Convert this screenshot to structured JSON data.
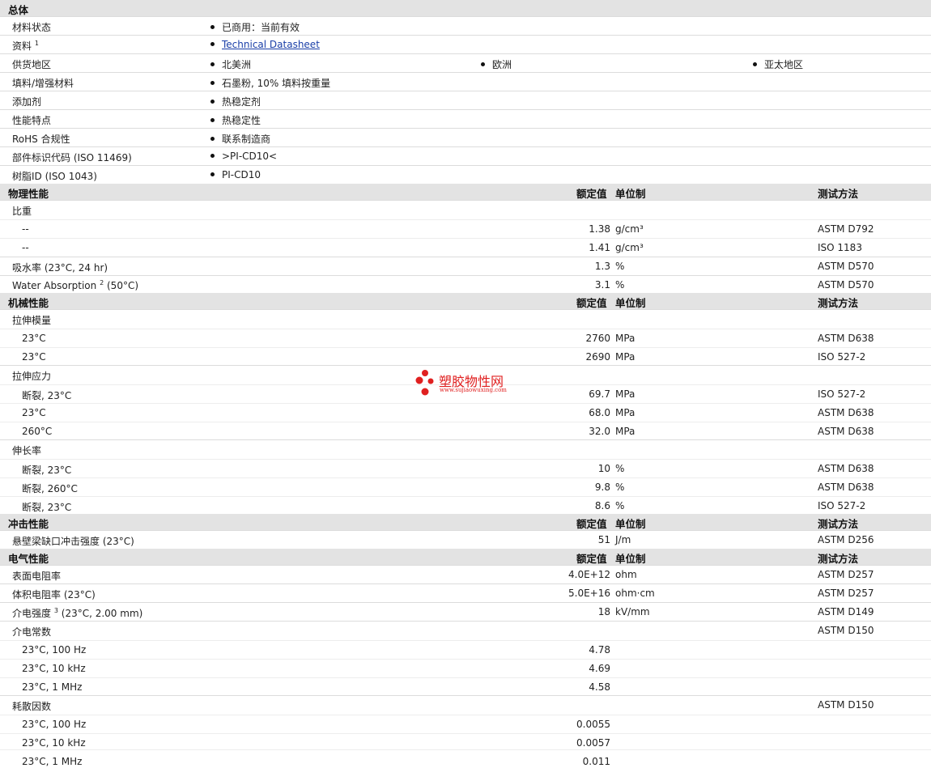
{
  "sections": {
    "general": {
      "title": "总体",
      "rows": [
        {
          "label": "材料状态",
          "values": [
            "已商用：当前有效"
          ]
        },
        {
          "label": "资料",
          "sup": "1",
          "values": [
            "Technical Datasheet"
          ]
        },
        {
          "label": "供货地区",
          "values": [
            "北美洲",
            "欧洲",
            "亚太地区"
          ]
        },
        {
          "label": "填料/增强材料",
          "values": [
            "石墨粉, 10% 填料按重量"
          ]
        },
        {
          "label": "添加剂",
          "values": [
            "热稳定剂"
          ]
        },
        {
          "label": "性能特点",
          "values": [
            "热稳定性"
          ]
        },
        {
          "label": "RoHS 合规性",
          "values": [
            "联系制造商"
          ]
        },
        {
          "label": "部件标识代码 (ISO 11469)",
          "values": [
            ">PI-CD10<"
          ]
        },
        {
          "label": "树脂ID (ISO 1043)",
          "values": [
            "PI-CD10"
          ]
        }
      ]
    },
    "col_headers": {
      "value": "额定值",
      "unit": "单位制",
      "method": "测试方法"
    },
    "physical": {
      "title": "物理性能",
      "rows": [
        {
          "label": "比重",
          "value": "",
          "unit": "",
          "method": ""
        },
        {
          "label": "--",
          "value": "1.38",
          "unit": "g/cm³",
          "method": "ASTM D792"
        },
        {
          "label": "--",
          "value": "1.41",
          "unit": "g/cm³",
          "method": "ISO 1183"
        },
        {
          "label": "吸水率 (23°C, 24 hr)",
          "value": "1.3",
          "unit": "%",
          "method": "ASTM D570"
        },
        {
          "label": "Water Absorption",
          "sup": "2",
          "label_tail": "(50°C)",
          "value": "3.1",
          "unit": "%",
          "method": "ASTM D570"
        }
      ]
    },
    "mechanical": {
      "title": "机械性能",
      "rows": [
        {
          "label": "拉伸模量",
          "value": "",
          "unit": "",
          "method": ""
        },
        {
          "label": "23°C",
          "value": "2760",
          "unit": "MPa",
          "method": "ASTM D638"
        },
        {
          "label": "23°C",
          "value": "2690",
          "unit": "MPa",
          "method": "ISO 527-2"
        },
        {
          "label": "拉伸应力",
          "value": "",
          "unit": "",
          "method": ""
        },
        {
          "label": "断裂, 23°C",
          "value": "69.7",
          "unit": "MPa",
          "method": "ISO 527-2"
        },
        {
          "label": "23°C",
          "value": "68.0",
          "unit": "MPa",
          "method": "ASTM D638"
        },
        {
          "label": "260°C",
          "value": "32.0",
          "unit": "MPa",
          "method": "ASTM D638"
        },
        {
          "label": "伸长率",
          "value": "",
          "unit": "",
          "method": ""
        },
        {
          "label": "断裂, 23°C",
          "value": "10",
          "unit": "%",
          "method": "ASTM D638"
        },
        {
          "label": "断裂, 260°C",
          "value": "9.8",
          "unit": "%",
          "method": "ASTM D638"
        },
        {
          "label": "断裂, 23°C",
          "value": "8.6",
          "unit": "%",
          "method": "ISO 527-2"
        }
      ]
    },
    "impact": {
      "title": "冲击性能",
      "rows": [
        {
          "label": "悬壁梁缺口冲击强度 (23°C)",
          "value": "51",
          "unit": "J/m",
          "method": "ASTM D256"
        }
      ]
    },
    "electrical": {
      "title": "电气性能",
      "rows": [
        {
          "label": "表面电阻率",
          "value": "4.0E+12",
          "unit": "ohm",
          "method": "ASTM D257"
        },
        {
          "label": "体积电阻率 (23°C)",
          "value": "5.0E+16",
          "unit": "ohm·cm",
          "method": "ASTM D257"
        },
        {
          "label": "介电强度",
          "sup": "3",
          "label_tail": "(23°C, 2.00 mm)",
          "value": "18",
          "unit": "kV/mm",
          "method": "ASTM D149"
        },
        {
          "label": "介电常数",
          "value": "",
          "unit": "",
          "method": "ASTM D150"
        },
        {
          "label": "23°C, 100 Hz",
          "value": "4.78",
          "unit": "",
          "method": ""
        },
        {
          "label": "23°C, 10 kHz",
          "value": "4.69",
          "unit": "",
          "method": ""
        },
        {
          "label": "23°C, 1 MHz",
          "value": "4.58",
          "unit": "",
          "method": ""
        },
        {
          "label": "耗散因数",
          "value": "",
          "unit": "",
          "method": "ASTM D150"
        },
        {
          "label": "23°C, 100 Hz",
          "value": "0.0055",
          "unit": "",
          "method": ""
        },
        {
          "label": "23°C, 10 kHz",
          "value": "0.0057",
          "unit": "",
          "method": ""
        },
        {
          "label": "23°C, 1 MHz",
          "value": "0.011",
          "unit": "",
          "method": ""
        }
      ]
    }
  },
  "watermark": {
    "name": "塑胶物性网",
    "url": "www.sujiaowuxing.com"
  },
  "colors": {
    "header_bg": "#e3e3e3",
    "link": "#1a3fa8",
    "watermark": "#e02020"
  }
}
